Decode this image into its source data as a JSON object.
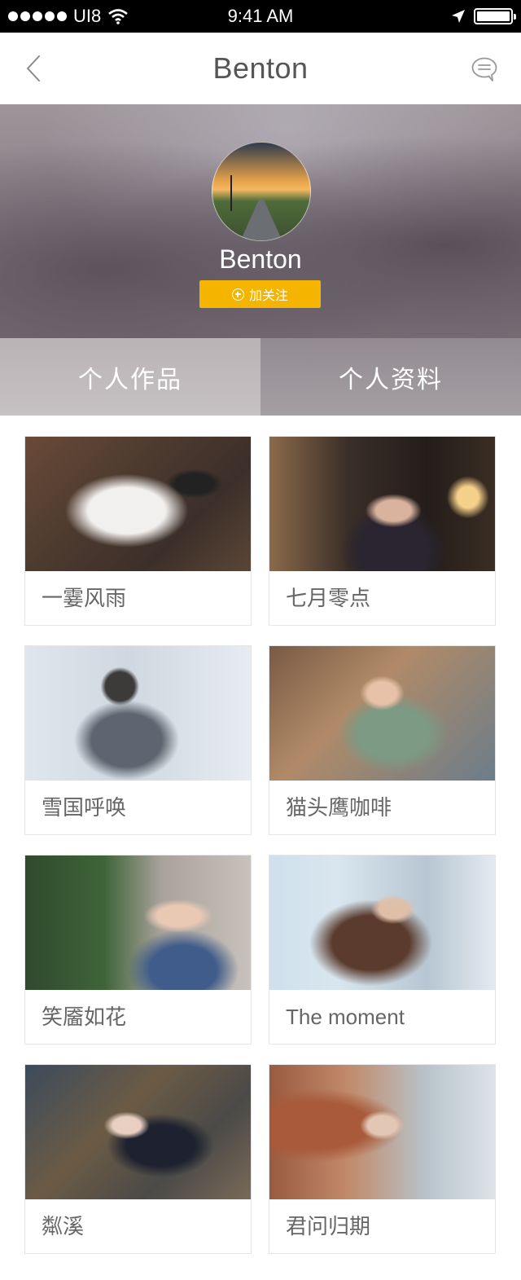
{
  "status_bar": {
    "carrier": "UI8",
    "time": "9:41 AM"
  },
  "nav": {
    "title": "Benton",
    "back_icon": "chevron-left-icon",
    "message_icon": "chat-bubble-icon"
  },
  "profile": {
    "name": "Benton",
    "follow_label": "加关注",
    "follow_icon": "plus-circle-icon",
    "follow_color": "#f5b400"
  },
  "tabs": [
    {
      "label": "个人作品",
      "active": true
    },
    {
      "label": "个人资料",
      "active": false
    }
  ],
  "works": [
    {
      "title": "一霎风雨"
    },
    {
      "title": "七月零点"
    },
    {
      "title": "雪国呼唤"
    },
    {
      "title": "猫头鹰咖啡"
    },
    {
      "title": "笑靥如花"
    },
    {
      "title": "The moment"
    },
    {
      "title": "粼溪"
    },
    {
      "title": "君问归期"
    }
  ]
}
